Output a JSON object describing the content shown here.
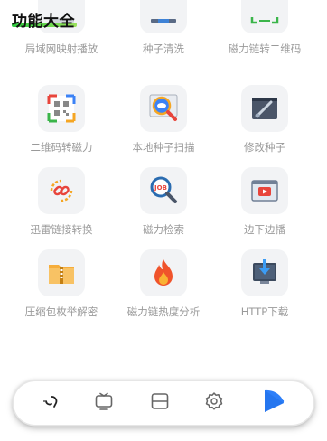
{
  "header": {
    "title": "功能大全"
  },
  "features": [
    {
      "label": "局域网映射播放",
      "icon": "network-cast-icon"
    },
    {
      "label": "种子清洗",
      "icon": "seed-clean-icon"
    },
    {
      "label": "磁力链转二维码",
      "icon": "qr-code-icon"
    },
    {
      "label": "二维码转磁力",
      "icon": "qr-scan-icon"
    },
    {
      "label": "本地种子扫描",
      "icon": "local-seed-scan-icon"
    },
    {
      "label": "修改种子",
      "icon": "edit-seed-icon"
    },
    {
      "label": "迅雷链接转换",
      "icon": "link-convert-icon"
    },
    {
      "label": "磁力检索",
      "icon": "magnet-search-icon"
    },
    {
      "label": "边下边播",
      "icon": "video-play-icon"
    },
    {
      "label": "压缩包枚举解密",
      "icon": "zip-decrypt-icon"
    },
    {
      "label": "磁力链热度分析",
      "icon": "fire-icon"
    },
    {
      "label": "HTTP下载",
      "icon": "download-icon"
    }
  ],
  "navbar": {
    "items": [
      {
        "name": "home",
        "icon": "link-icon"
      },
      {
        "name": "tv",
        "icon": "tv-icon"
      },
      {
        "name": "tasks",
        "icon": "cards-icon"
      },
      {
        "name": "settings",
        "icon": "gear-icon"
      },
      {
        "name": "active",
        "icon": "blue-fan-icon"
      }
    ]
  },
  "colors": {
    "accent_green": "#2ecc40",
    "label_gray": "#9a9a9a",
    "tile_bg": "#f2f3f5",
    "active_blue": "#2d7ff9"
  }
}
